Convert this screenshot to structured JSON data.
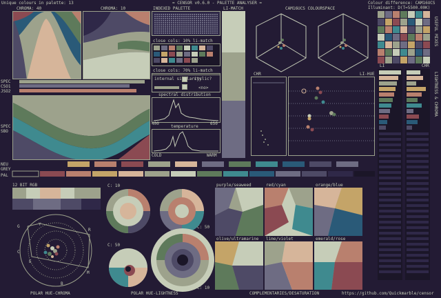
{
  "header": {
    "unique_colours": "Unique colours in palette: 13",
    "title": "= CENSOR v0.6.0 - PALETTE ANALYSER =",
    "colour_difference": "Colour difference: CAM16UCS",
    "illuminant": "Illuminant: D(T=5500.00K)"
  },
  "labels": {
    "chroma40": "CHROMA: 40",
    "chroma10": "CHROMA: 10",
    "indexed_palette": "INDEXED PALETTE",
    "li_match": "LI-MATCH",
    "cam16ucs": "CAM16UCS COLOURSPACE",
    "close_10": "close cols: 10% li-match",
    "close_70": "close cols: 70% li-match",
    "internal_similarity": "internal similarity",
    "cyclic": "cyclic?",
    "no": "<no>",
    "spectral": "spectral distribution",
    "nm400": "400",
    "nm650": "650",
    "temperature": "temperature",
    "cold": "COLD",
    "warm": "WARM",
    "char": "CHR",
    "li_hue": "LI-HUE",
    "li": "LI",
    "chr2": "CHR",
    "spec": "SPEC",
    "cso1": "CSO1",
    "jso2": "JSO2",
    "spec2": "SPEC",
    "sbo": "SBO",
    "neu": "NEU",
    "grey": "GREY",
    "pal": "PAL",
    "bit12": "12 BIT RGB",
    "c10a": "C: 10",
    "c50a": "C: 50",
    "c50b": "C: 50",
    "c10b": "C: 10",
    "polar_hue_chroma": "POLAR HUE-CHROMA",
    "polar_hue_lightness": "POLAR HUE-LIGHTNESS",
    "complementaries": "COMPLEMENTARIES/DESATURATION",
    "github": "https://github.com/Quickmarble/censor",
    "purple_seaweed": "purple/seaweed",
    "red_cyan": "red/cyan",
    "orange_blue": "orange/blue",
    "olive_ultramarine": "olive/ultramarine",
    "lime_violet": "lime/violet",
    "emerald_rose": "emerald/rose",
    "useful_mixes": "USEFUL MIXES",
    "lightness_chroma": "LIGHTNESS & CHROMA",
    "pc_letters": [
      "G",
      "Y",
      "R",
      "C",
      "E",
      "M",
      "B"
    ]
  },
  "palette": [
    "#1b1628",
    "#2f2848",
    "#4e4a66",
    "#6e6c83",
    "#9da28c",
    "#c6cdb8",
    "#d6b59a",
    "#b9806e",
    "#8b4a52",
    "#5e7a5b",
    "#3f8a8f",
    "#2a5a78",
    "#c4a468"
  ]
}
